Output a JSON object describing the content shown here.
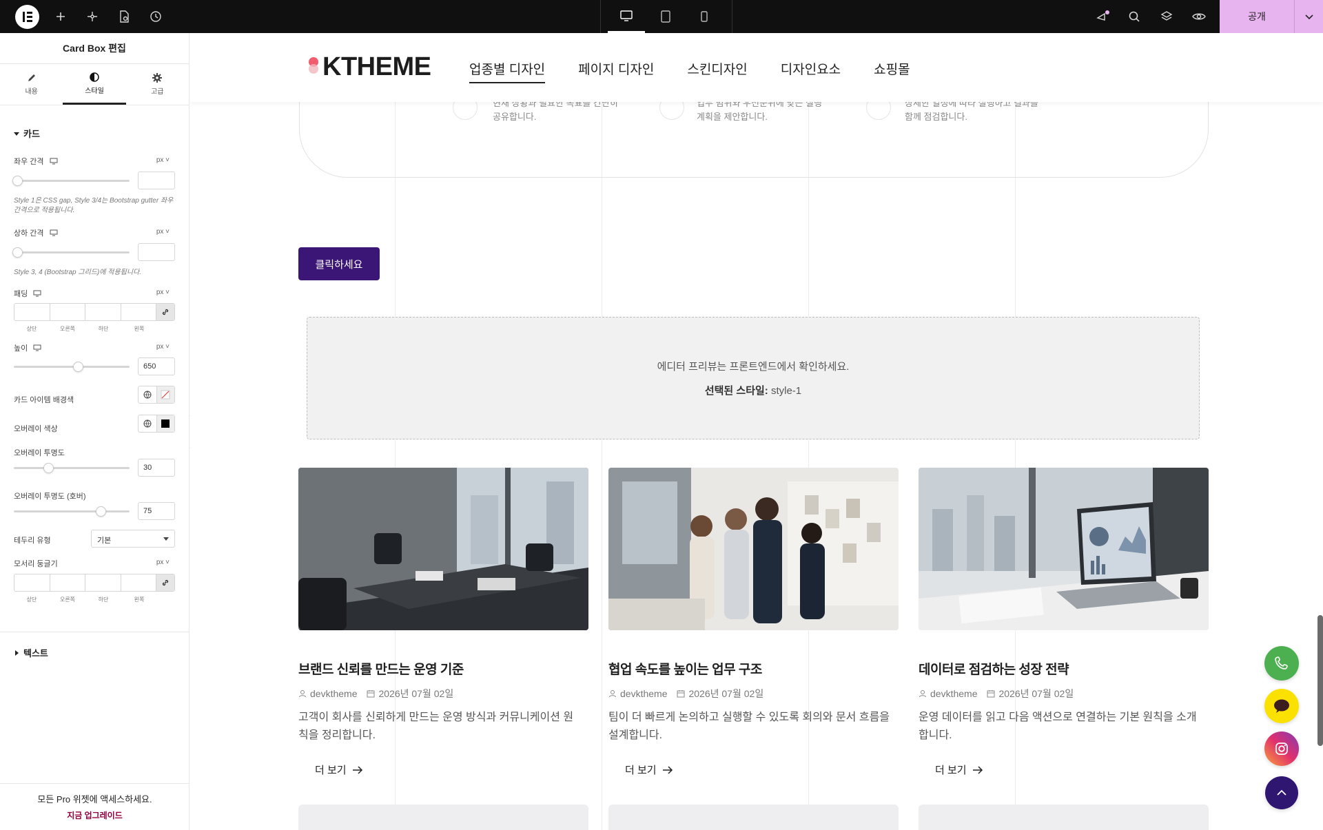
{
  "topbar": {
    "publish_label": "공개",
    "icons": [
      "elementor-logo-icon",
      "add-icon",
      "ai-sparkle-icon",
      "page-settings-icon",
      "history-icon",
      "desktop-icon",
      "tablet-icon",
      "mobile-icon",
      "whats-new-icon",
      "search-icon",
      "structure-layers-icon",
      "preview-eye-icon",
      "chevron-down-icon"
    ],
    "accent": "#e8b4ef"
  },
  "panel": {
    "title": "Card Box 편집",
    "tabs": [
      {
        "label": "내용",
        "icon": "pencil-icon"
      },
      {
        "label": "스타일",
        "icon": "half-circle-icon"
      },
      {
        "label": "고급",
        "icon": "gear-icon"
      }
    ],
    "section_card": "카드",
    "gap_x_label": "좌우 간격",
    "gap_x_unit": "px",
    "gap_x_value": "",
    "gap_x_hint": "Style 1은 CSS gap, Style 3/4는 Bootstrap gutter 좌우 간격으로 적용됩니다.",
    "gap_y_label": "상하 간격",
    "gap_y_unit": "px",
    "gap_y_value": "",
    "gap_y_hint": "Style 3, 4 (Bootstrap 그리드)에 적용됩니다.",
    "padding_label": "패딩",
    "padding_unit": "px",
    "quad_labels": [
      "상단",
      "오른쪽",
      "하단",
      "왼쪽"
    ],
    "height_label": "높이",
    "height_unit": "px",
    "height_value": "650",
    "card_bg_label": "카드 아이템 배경색",
    "overlay_color_label": "오버레이 색상",
    "overlay_opacity_label": "오버레이 투명도",
    "overlay_opacity_value": "30",
    "overlay_hover_label": "오버레이 투명도 (호버)",
    "overlay_hover_value": "75",
    "border_type_label": "테두리 유형",
    "border_type_value": "기본",
    "radius_label": "모서리 둥글기",
    "radius_unit": "px",
    "section_text": "텍스트",
    "promo_line1": "모든 Pro 위젯에 액세스하세요.",
    "promo_line2": "지금 업그레이드"
  },
  "site": {
    "brand": "KTHEME",
    "nav": [
      "업종별 디자인",
      "페이지 디자인",
      "스킨디자인",
      "디자인요소",
      "쇼핑몰"
    ],
    "steps": [
      [
        "현재 상황과 필요한 목표를 간단히",
        "공유합니다."
      ],
      [
        "업무 범위와 우선순위에 맞는 실행",
        "계획을 제안합니다."
      ],
      [
        "상세한 일정에 따라 실행하고 결과를",
        "함께 점검합니다."
      ]
    ],
    "cta_label": "클릭하세요",
    "preview_line1": "에디터 프리뷰는 프론트엔드에서 확인하세요.",
    "preview_style_label": "선택된 스타일:",
    "preview_style_value": "style-1",
    "cards": [
      {
        "title": "브랜드 신뢰를 만드는 운영 기준",
        "author": "devktheme",
        "date": "2026년 07월 02일",
        "desc": "고객이 회사를 신뢰하게 만드는 운영 방식과 커뮤니케이션 원칙을 정리합니다.",
        "more": "더 보기"
      },
      {
        "title": "협업 속도를 높이는 업무 구조",
        "author": "devktheme",
        "date": "2026년 07월 02일",
        "desc": "팀이 더 빠르게 논의하고 실행할 수 있도록 회의와 문서 흐름을 설계합니다.",
        "more": "더 보기"
      },
      {
        "title": "데이터로 점검하는 성장 전략",
        "author": "devktheme",
        "date": "2026년 07월 02일",
        "desc": "운영 데이터를 읽고 다음 액션으로 연결하는 기본 원칙을 소개합니다.",
        "more": "더 보기"
      }
    ],
    "float_buttons": [
      "phone-icon",
      "chat-bubble-icon",
      "instagram-icon",
      "arrow-up-icon"
    ]
  }
}
